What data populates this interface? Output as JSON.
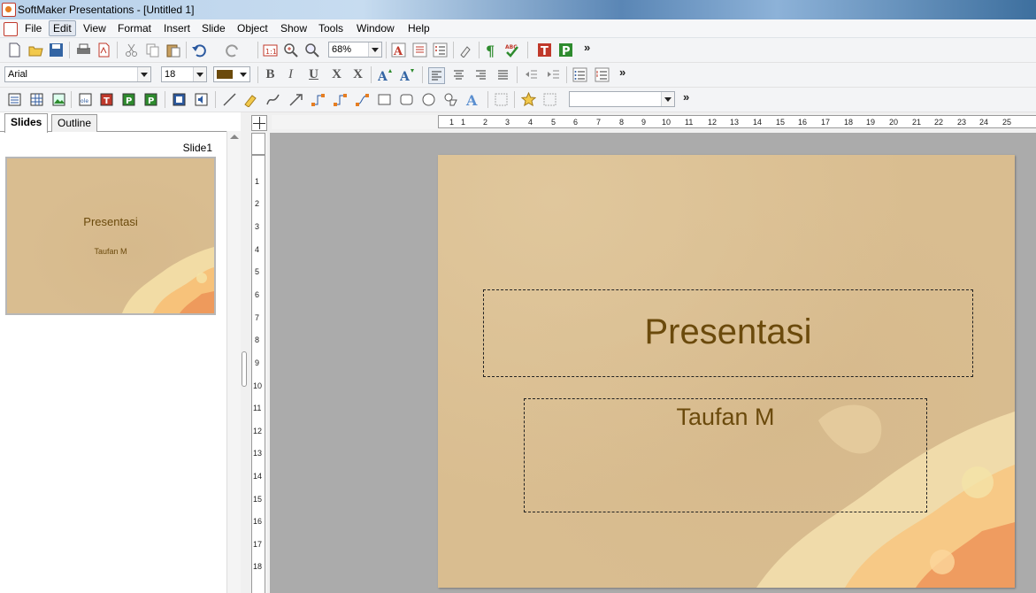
{
  "window": {
    "title": "SoftMaker Presentations - [Untitled 1]"
  },
  "menu": [
    "File",
    "Edit",
    "View",
    "Format",
    "Insert",
    "Slide",
    "Object",
    "Show",
    "Tools",
    "Window",
    "Help"
  ],
  "toolbar": {
    "zoom": "68%",
    "font_name": "Arial",
    "font_size": "18",
    "style_value": "",
    "overflow": "»"
  },
  "panel": {
    "tab_slides": "Slides",
    "tab_outline": "Outline",
    "slide_label": "Slide1"
  },
  "slide": {
    "title": "Presentasi",
    "subtitle": "Taufan M"
  },
  "colors": {
    "text": "#6b4a0c",
    "background": "#d9bd90",
    "font_color_swatch": "#6b4a0c"
  },
  "ruler": {
    "horizontal": [
      "1",
      "1",
      "2",
      "3",
      "4",
      "5",
      "6",
      "7",
      "8",
      "9",
      "10",
      "11",
      "12",
      "13",
      "14",
      "15",
      "16",
      "17",
      "18",
      "19",
      "20",
      "21",
      "22",
      "23",
      "24",
      "25"
    ],
    "vertical": [
      "1",
      "2",
      "3",
      "4",
      "5",
      "6",
      "7",
      "8",
      "9",
      "10",
      "11",
      "12",
      "13",
      "14",
      "15",
      "16",
      "17",
      "18"
    ]
  }
}
